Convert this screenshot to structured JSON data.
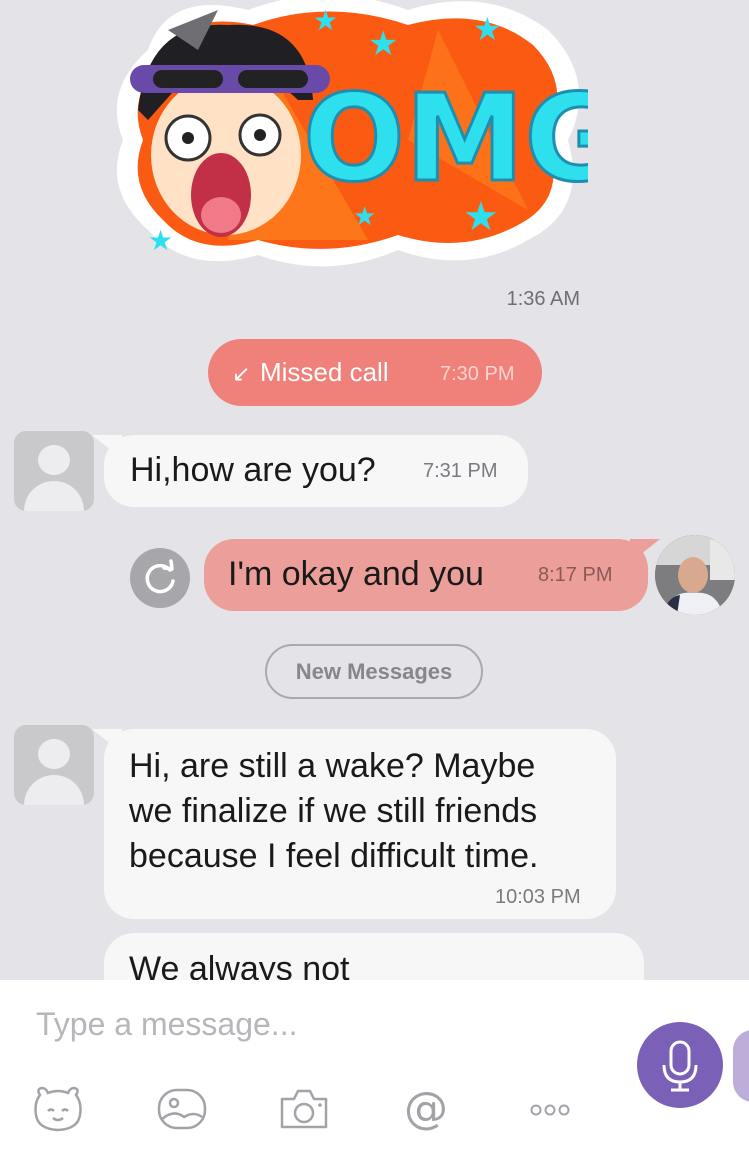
{
  "sticker": {
    "text": "OMG",
    "time": "1:36 AM"
  },
  "missed_call": {
    "label": "Missed call",
    "time": "7:30 PM"
  },
  "messages": [
    {
      "text": "Hi,how are you?",
      "time": "7:31 PM",
      "direction": "incoming"
    },
    {
      "text": "I'm okay and you",
      "time": "8:17 PM",
      "direction": "outgoing"
    },
    {
      "lines": [
        "Hi, are still a wake? Maybe",
        "we finalize if we still friends",
        "because I feel difficult time."
      ],
      "time": "10:03 PM",
      "direction": "incoming"
    },
    {
      "text": "We always not",
      "direction": "incoming"
    }
  ],
  "new_messages_label": "New Messages",
  "composer": {
    "placeholder": "Type a message..."
  },
  "toolbar": [
    "sticker-icon",
    "gallery-icon",
    "camera-icon",
    "mention-icon",
    "more-icon"
  ],
  "colors": {
    "missed_call": "#f0807a",
    "outgoing": "#ec9f9a",
    "incoming": "#f7f7f8",
    "accent": "#7b60b8"
  }
}
